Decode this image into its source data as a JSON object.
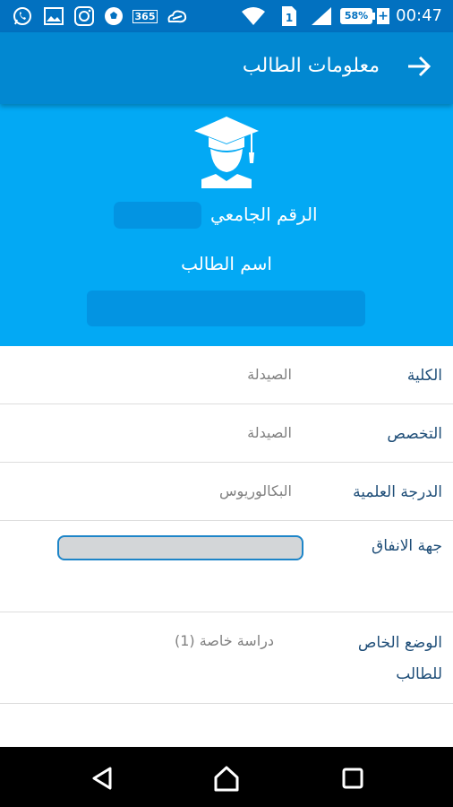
{
  "status_bar": {
    "time": "00:47",
    "battery_level": "58%",
    "battery_fraction": 0.58,
    "left_icons": [
      "whatsapp-icon",
      "gallery-icon",
      "instagram-icon",
      "soccer-icon",
      "app-365-icon",
      "cloud-app-icon"
    ],
    "right_icons": [
      "wifi-icon",
      "sim-1-icon",
      "signal-icon",
      "battery-icon"
    ],
    "app_365_label": "365"
  },
  "app_bar": {
    "title": "معلومات الطالب",
    "back_icon": "arrow-right-icon"
  },
  "header": {
    "icon": "graduate-icon",
    "student_id_label": "الرقم الجامعي",
    "student_name_label": "اسم الطالب"
  },
  "info": {
    "college": {
      "label": "الكلية",
      "value": "الصيدلة"
    },
    "major": {
      "label": "التخصص",
      "value": "الصيدلة"
    },
    "degree": {
      "label": "الدرجة العلمية",
      "value": "البكالوريوس"
    },
    "funding": {
      "label": "جهة الانفاق"
    },
    "status": {
      "label_line1": "الوضع الخاص",
      "label_line2": "للطالب",
      "value": "دراسة خاصة (1)"
    }
  },
  "nav_bar": {
    "icons": [
      "back-triangle-icon",
      "home-icon",
      "recents-icon"
    ]
  },
  "colors": {
    "status_bar": "#0271c0",
    "app_bar": "#0288d1",
    "header": "#03a9f4",
    "label_text": "#1f4e78",
    "value_text": "#808080"
  }
}
